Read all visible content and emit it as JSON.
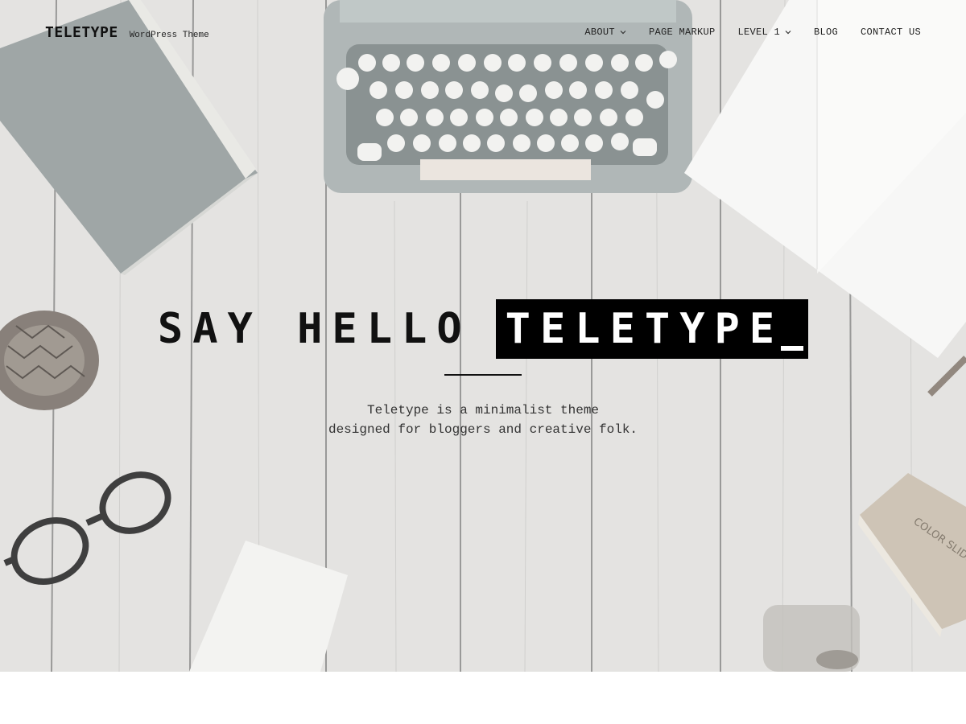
{
  "header": {
    "site_title": "TELETYPE",
    "site_description": "WordPress Theme"
  },
  "nav": {
    "items": [
      {
        "label": "ABOUT",
        "has_submenu": true
      },
      {
        "label": "PAGE MARKUP",
        "has_submenu": false
      },
      {
        "label": "LEVEL 1",
        "has_submenu": true
      },
      {
        "label": "BLOG",
        "has_submenu": false
      },
      {
        "label": "CONTACT US",
        "has_submenu": false
      }
    ]
  },
  "hero": {
    "headline_plain": "SAY HELLO",
    "headline_highlight": "TELETYPE",
    "tagline_line1": "Teletype is a minimalist theme",
    "tagline_line2": "designed for bloggers and creative folk.",
    "image_subjects": [
      "typewriter-icon",
      "book-icon",
      "notebook-icon",
      "pinecone-icon",
      "eyeglasses-icon",
      "card-icon",
      "slide-box-icon",
      "jar-icon"
    ],
    "box_text": "COLOR SLIDES"
  },
  "colors": {
    "text": "#111111",
    "highlight_bg": "#000000",
    "highlight_text": "#ffffff",
    "wood": "#dcdcd9"
  }
}
